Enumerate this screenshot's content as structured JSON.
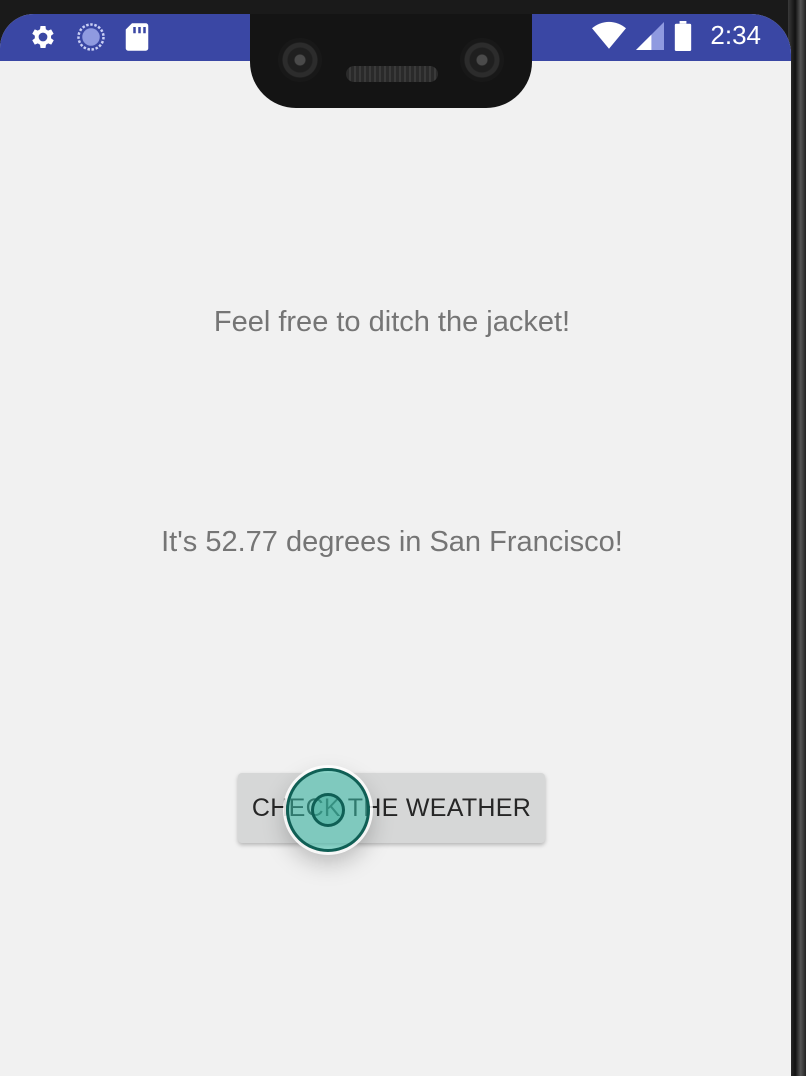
{
  "status_bar": {
    "time": "2:34",
    "color": "#3a47a4",
    "left_icons": [
      "settings-icon",
      "sync-icon",
      "sd-card-icon"
    ],
    "right_icons": [
      "wifi-icon",
      "cell-signal-icon",
      "battery-icon"
    ]
  },
  "main": {
    "advice_text": "Feel free to ditch the jacket!",
    "temperature_text": "It's 52.77 degrees in San Francisco!",
    "check_button_label": "CHECK THE WEATHER"
  },
  "colors": {
    "background": "#f1f1f1",
    "text": "#757575",
    "button": "#d6d7d7",
    "touch_indicator": "#38beaa"
  }
}
